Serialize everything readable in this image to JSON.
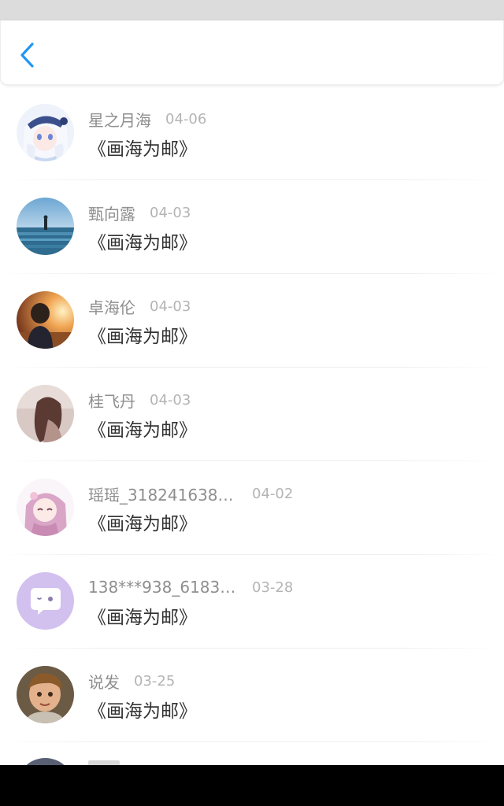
{
  "header": {
    "back_icon": "chevron-left-icon",
    "accent_color": "#2196f3"
  },
  "messages": [
    {
      "name": "星之月海",
      "date": "04-06",
      "title": "《画海为邮》",
      "avatar": "anime-girl-white-hair-avatar"
    },
    {
      "name": "甄向露",
      "date": "04-03",
      "title": "《画海为邮》",
      "avatar": "person-at-sea-avatar"
    },
    {
      "name": "卓海伦",
      "date": "04-03",
      "title": "《画海为邮》",
      "avatar": "boy-sunset-avatar"
    },
    {
      "name": "桂飞丹",
      "date": "04-03",
      "title": "《画海为邮》",
      "avatar": "woman-looking-up-avatar"
    },
    {
      "name": "瑶瑶_3182416386...",
      "date": "04-02",
      "title": "《画海为邮》",
      "avatar": "anime-girl-pink-hair-avatar"
    },
    {
      "name": "138***938_618349...",
      "date": "03-28",
      "title": "《画海为邮》",
      "avatar": "default-chat-bubble-avatar"
    },
    {
      "name": "说发",
      "date": "03-25",
      "title": "《画海为邮》",
      "avatar": "child-photo-avatar"
    }
  ]
}
